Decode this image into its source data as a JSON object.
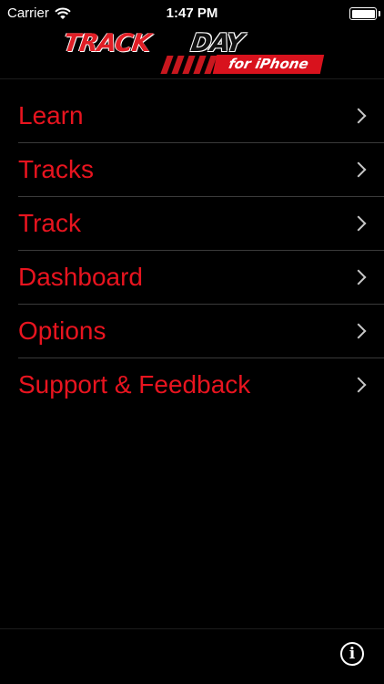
{
  "status_bar": {
    "carrier": "Carrier",
    "time": "1:47 PM",
    "battery_level": 1.0
  },
  "logo": {
    "word1": "TRACK",
    "word2": "DAY",
    "badge": "for iPhone",
    "brand_red": "#e01e26"
  },
  "menu": {
    "items": [
      {
        "label": "Learn"
      },
      {
        "label": "Tracks"
      },
      {
        "label": "Track"
      },
      {
        "label": "Dashboard"
      },
      {
        "label": "Options"
      },
      {
        "label": "Support & Feedback"
      }
    ]
  },
  "toolbar": {
    "info_icon": "info-icon",
    "info_glyph": "i"
  }
}
